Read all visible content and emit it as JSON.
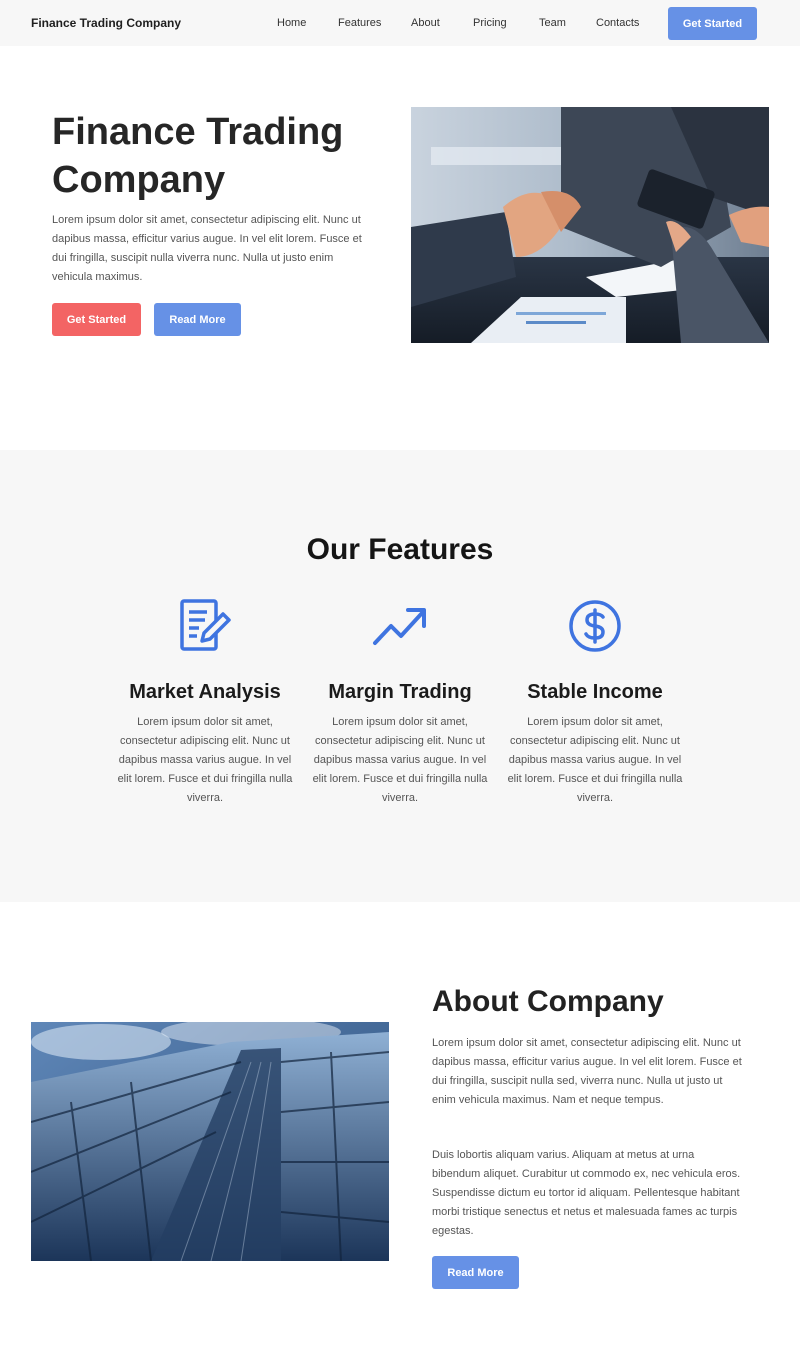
{
  "nav": {
    "brand": "Finance Trading Company",
    "links": [
      "Home",
      "Features",
      "About",
      "Pricing",
      "Team",
      "Contacts"
    ],
    "cta": "Get Started"
  },
  "hero": {
    "title": "Finance Trading Company",
    "text": "Lorem ipsum dolor sit amet, consectetur adipiscing elit. Nunc ut dapibus massa, efficitur varius augue. In vel elit lorem. Fusce et dui fringilla, suscipit nulla viverra nunc. Nulla ut justo enim vehicula maximus.",
    "primary_button": "Get Started",
    "secondary_button": "Read More"
  },
  "features": {
    "title": "Our Features",
    "items": [
      {
        "icon": "document-edit-icon",
        "title": "Market Analysis",
        "text": "Lorem ipsum dolor sit amet, consectetur adipiscing elit. Nunc ut dapibus massa varius augue. In vel elit lorem. Fusce et dui fringilla nulla viverra."
      },
      {
        "icon": "trending-up-icon",
        "title": "Margin Trading",
        "text": "Lorem ipsum dolor sit amet, consectetur adipiscing elit. Nunc ut dapibus massa varius augue. In vel elit lorem. Fusce et dui fringilla nulla viverra."
      },
      {
        "icon": "dollar-coin-icon",
        "title": "Stable Income",
        "text": "Lorem ipsum dolor sit amet, consectetur adipiscing elit. Nunc ut dapibus massa varius augue. In vel elit lorem. Fusce et dui fringilla nulla viverra."
      }
    ]
  },
  "about": {
    "title": "About Company",
    "paragraph1": "Lorem ipsum dolor sit amet, consectetur adipiscing elit. Nunc ut dapibus massa, efficitur varius augue. In vel elit lorem. Fusce et dui fringilla, suscipit nulla sed, viverra nunc. Nulla ut justo ut enim vehicula maximus. Nam et neque tempus.",
    "paragraph2": "Duis lobortis aliquam varius. Aliquam at metus at urna bibendum aliquet. Curabitur ut commodo ex, nec vehicula eros. Suspendisse dictum eu tortor id aliquam. Pellentesque habitant morbi tristique senectus et netus et malesuada fames ac turpis egestas.",
    "button": "Read More"
  },
  "colors": {
    "accent_blue": "#6691e6",
    "accent_red": "#f36464",
    "icon_blue": "#3f74e0",
    "section_bg": "#f7f7f7"
  }
}
